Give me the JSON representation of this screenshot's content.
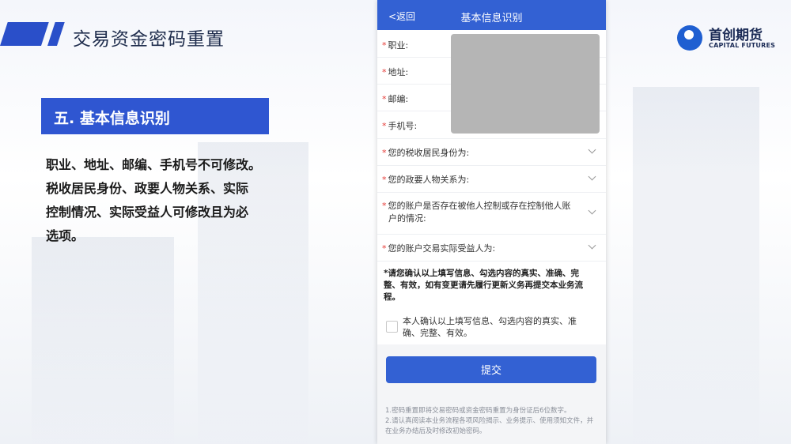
{
  "slide": {
    "title": "交易资金密码重置",
    "logo_cn": "首创期货",
    "logo_en": "CAPITAL FUTURES",
    "section_heading": "五. 基本信息识别",
    "description_lines": [
      "职业、地址、邮编、手机号不可修改。",
      "税收居民身份、政要人物关系、实际",
      "控制情况、实际受益人可修改且为必",
      "选项。"
    ]
  },
  "phone": {
    "nav": {
      "back_label": "<返回",
      "title": "基本信息识别"
    },
    "locked_fields": [
      {
        "label": "职业:"
      },
      {
        "label": "地址:"
      },
      {
        "label": "邮编:"
      },
      {
        "label": "手机号:"
      }
    ],
    "selects": [
      {
        "label": "您的税收居民身份为:"
      },
      {
        "label": "您的政要人物关系为:"
      },
      {
        "label_lines": [
          "您的账户是否存在被他人控制或存在控制他人账",
          "户的情况:"
        ]
      },
      {
        "label": "您的账户交易实际受益人为:"
      }
    ],
    "required_mark": "*",
    "notice_lines": [
      "*请您确认以上填写信息、勾选内容的真实、准确、完",
      "整、有效，如有变更请先履行更新义务再提交本业务流",
      "程。"
    ],
    "confirm_lines": [
      "本人确认以上填写信息、勾选内容的真实、准",
      "确、完整、有效。"
    ],
    "submit_label": "提交",
    "tips_lines": [
      "1.密码重置即将交易密码或资金密码重置为身份证后6位数字。",
      "2.请认真阅读本业务流程各项风险揭示、业务提示、使用须知文件，并",
      "在业务办结后及时修改初始密码。"
    ]
  }
}
